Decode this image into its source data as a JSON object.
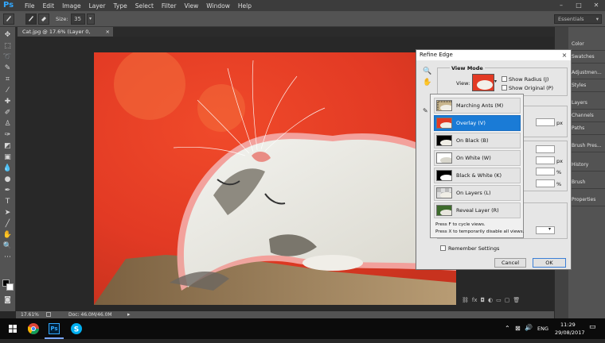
{
  "app": {
    "logo": "Ps"
  },
  "menu": [
    "File",
    "Edit",
    "Image",
    "Layer",
    "Type",
    "Select",
    "Filter",
    "View",
    "Window",
    "Help"
  ],
  "window_controls": [
    "–",
    "□",
    "✕"
  ],
  "options_bar": {
    "size_label": "Size:",
    "size_value": "35",
    "workspace": "Essentials"
  },
  "document": {
    "tab_title": "Cat.jpg @ 17.6% (Layer 0, RGB/8#) *",
    "tab_close": "×"
  },
  "status": {
    "zoom": "17.61%",
    "doc_info": "Doc: 46.0M/46.0M"
  },
  "panels": [
    "Color",
    "Swatches",
    "Adjustmen...",
    "Styles",
    "Layers",
    "Channels",
    "Paths",
    "Brush Pres...",
    "History",
    "Brush",
    "Properties"
  ],
  "dialog": {
    "title": "Refine Edge",
    "close": "×",
    "view_mode_heading": "View Mode",
    "view_label": "View:",
    "show_radius": "Show Radius (J)",
    "show_original": "Show Original (P)",
    "px_unit": "px",
    "percent_unit": "%",
    "remember_settings": "Remember Settings",
    "cancel": "Cancel",
    "ok": "OK"
  },
  "view_modes": [
    {
      "label": "Marching Ants (M)",
      "selected": false
    },
    {
      "label": "Overlay (V)",
      "selected": true
    },
    {
      "label": "On Black (B)",
      "selected": false
    },
    {
      "label": "On White (W)",
      "selected": false
    },
    {
      "label": "Black & White (K)",
      "selected": false
    },
    {
      "label": "On Layers (L)",
      "selected": false
    },
    {
      "label": "Reveal Layer (R)",
      "selected": false
    }
  ],
  "view_hints": [
    "Press F to cycle views.",
    "Press X to temporarily disable all views."
  ],
  "taskbar": {
    "language": "ENG",
    "time": "11:29",
    "date": "29/08/2017"
  },
  "colors": {
    "accent": "#1a7bd6",
    "overlay_red": "#e8332a",
    "ps_blue": "#31a8ff"
  }
}
